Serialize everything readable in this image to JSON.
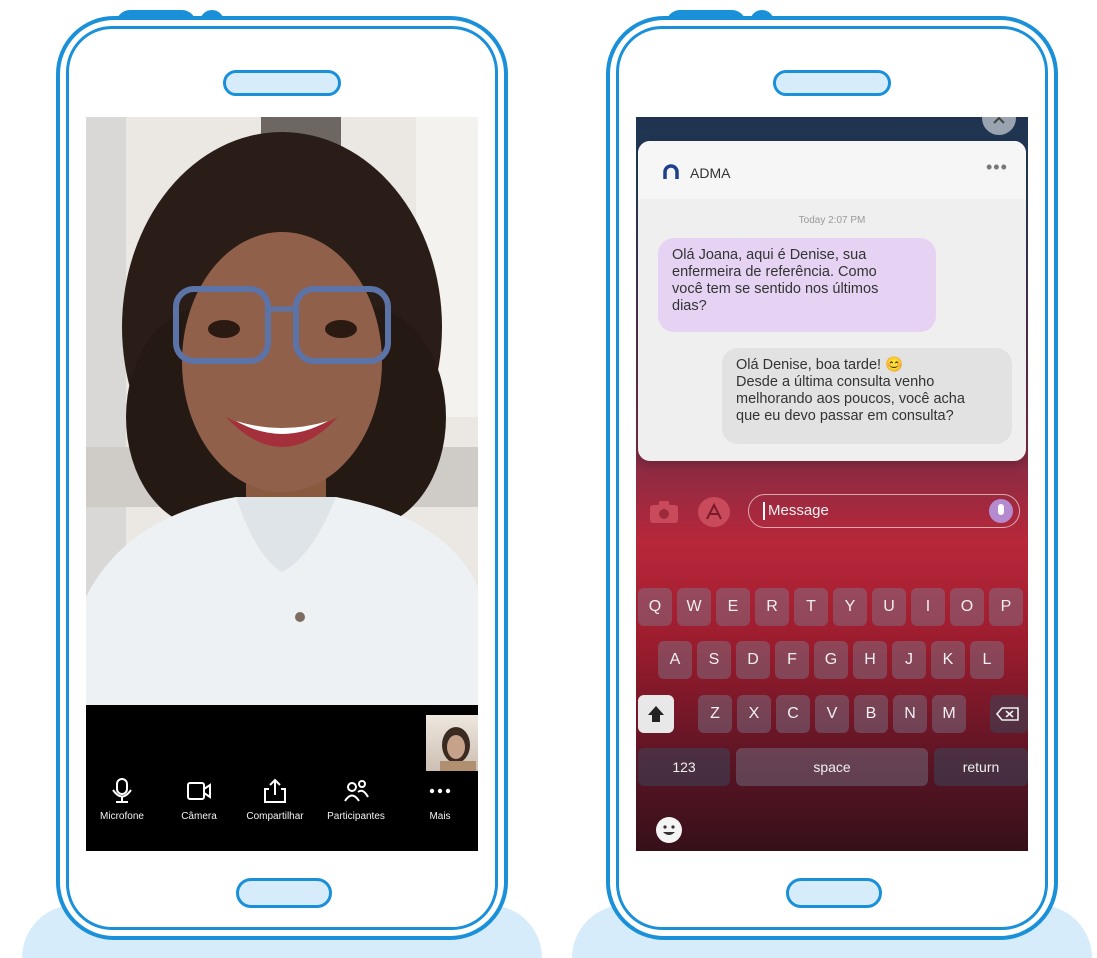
{
  "left_phone": {
    "controls": [
      {
        "label": "Microfone",
        "icon": "microphone-icon"
      },
      {
        "label": "Câmera",
        "icon": "camera-icon"
      },
      {
        "label": "Compartilhar",
        "icon": "share-icon"
      },
      {
        "label": "Participantes",
        "icon": "participants-icon"
      },
      {
        "label": "Mais",
        "icon": "more-icon"
      }
    ]
  },
  "right_phone": {
    "app_name": "ADMA",
    "timestamp": "Today 2:07 PM",
    "messages": [
      {
        "from": "received",
        "text": "Olá Joana, aqui é Denise, sua\nenfermeira de referência. Como\nvocê tem se sentido nos últimos\ndias?"
      },
      {
        "from": "sent",
        "text": "Olá Denise, boa tarde! 😊\nDesde a última consulta venho\nmelhorando aos poucos, você acha\nque eu devo passar em consulta?"
      }
    ],
    "input_placeholder": "Message",
    "keyboard": {
      "row1": [
        "Q",
        "W",
        "E",
        "R",
        "T",
        "Y",
        "U",
        "I",
        "O",
        "P"
      ],
      "row2": [
        "A",
        "S",
        "D",
        "F",
        "G",
        "H",
        "J",
        "K",
        "L"
      ],
      "row3": [
        "Z",
        "X",
        "C",
        "V",
        "B",
        "N",
        "M"
      ],
      "key_123": "123",
      "key_space": "space",
      "key_return": "return"
    }
  },
  "colors": {
    "phone_outline": "#1a90d9",
    "phone_accent": "#d6ecfb",
    "received_bubble": "#e6d3f3",
    "sent_bubble": "#e2e2e2"
  }
}
